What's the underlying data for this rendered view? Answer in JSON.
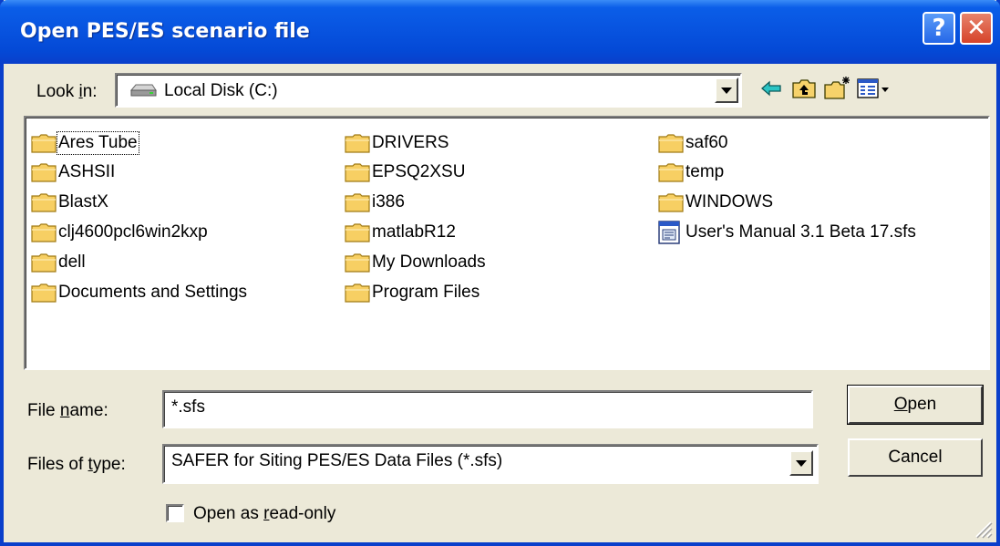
{
  "window": {
    "title": "Open PES/ES scenario file",
    "help_symbol": "?",
    "close_symbol": "✕"
  },
  "lookin": {
    "label": "Look in:",
    "value": "Local Disk (C:)",
    "icon": "hard-disk-icon"
  },
  "toolbar": {
    "icons": [
      "back-icon",
      "up-folder-icon",
      "new-folder-icon",
      "view-menu-icon"
    ]
  },
  "files": [
    {
      "name": "Ares Tube",
      "type": "folder"
    },
    {
      "name": "ASHSII",
      "type": "folder"
    },
    {
      "name": "BlastX",
      "type": "folder"
    },
    {
      "name": "clj4600pcl6win2kxp",
      "type": "folder"
    },
    {
      "name": "dell",
      "type": "folder"
    },
    {
      "name": "Documents and Settings",
      "type": "folder"
    },
    {
      "name": "DRIVERS",
      "type": "folder"
    },
    {
      "name": "EPSQ2XSU",
      "type": "folder"
    },
    {
      "name": "i386",
      "type": "folder"
    },
    {
      "name": "matlabR12",
      "type": "folder"
    },
    {
      "name": "My Downloads",
      "type": "folder"
    },
    {
      "name": "Program Files",
      "type": "folder"
    },
    {
      "name": "saf60",
      "type": "folder"
    },
    {
      "name": "temp",
      "type": "folder"
    },
    {
      "name": "WINDOWS",
      "type": "folder"
    },
    {
      "name": "User's Manual 3.1 Beta 17.sfs",
      "type": "file"
    }
  ],
  "filename": {
    "label": "File name:",
    "value": "*.sfs"
  },
  "filetype": {
    "label": "Files of type:",
    "value": "SAFER for Siting PES/ES Data Files (*.sfs)"
  },
  "readonly": {
    "label": "Open as read-only",
    "checked": false
  },
  "buttons": {
    "open": "Open",
    "cancel": "Cancel"
  },
  "colors": {
    "titlebar": "#0854e0",
    "face": "#ece9d8",
    "folder": "#f4c85a"
  }
}
